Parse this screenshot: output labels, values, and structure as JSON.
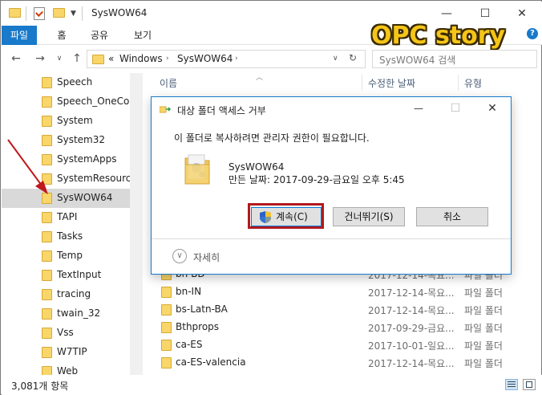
{
  "window": {
    "title": "SysWOW64",
    "minimize_glyph": "—",
    "maximize_glyph": "☐",
    "close_glyph": "✕"
  },
  "ribbon": {
    "tabs": [
      "파일",
      "홈",
      "공유",
      "보기"
    ],
    "help_glyph": "?"
  },
  "brand": "OPC story",
  "address": {
    "overflow": "«",
    "crumbs": [
      "Windows",
      "SysWOW64"
    ],
    "search_placeholder": "SysWOW64 검색"
  },
  "sidebar": {
    "items": [
      {
        "label": "Speech",
        "selected": false
      },
      {
        "label": "Speech_OneCore",
        "selected": false
      },
      {
        "label": "System",
        "selected": false
      },
      {
        "label": "System32",
        "selected": false
      },
      {
        "label": "SystemApps",
        "selected": false
      },
      {
        "label": "SystemResources",
        "selected": false
      },
      {
        "label": "SysWOW64",
        "selected": true
      },
      {
        "label": "TAPI",
        "selected": false
      },
      {
        "label": "Tasks",
        "selected": false
      },
      {
        "label": "Temp",
        "selected": false
      },
      {
        "label": "TextInput",
        "selected": false
      },
      {
        "label": "tracing",
        "selected": false
      },
      {
        "label": "twain_32",
        "selected": false
      },
      {
        "label": "Vss",
        "selected": false
      },
      {
        "label": "W7TIP",
        "selected": false
      },
      {
        "label": "Web",
        "selected": false
      }
    ]
  },
  "filelist": {
    "columns": [
      "이름",
      "수정한 날짜",
      "유형"
    ],
    "rows": [
      {
        "name": "bn-BD",
        "date": "2017-12-14-목요...",
        "type": "파일 폴더"
      },
      {
        "name": "bn-IN",
        "date": "2017-12-14-목요...",
        "type": "파일 폴더"
      },
      {
        "name": "bs-Latn-BA",
        "date": "2017-12-14-목요...",
        "type": "파일 폴더"
      },
      {
        "name": "Bthprops",
        "date": "2017-09-29-금요...",
        "type": "파일 폴더"
      },
      {
        "name": "ca-ES",
        "date": "2017-10-01-일요...",
        "type": "파일 폴더"
      },
      {
        "name": "ca-ES-valencia",
        "date": "2017-12-14-목요...",
        "type": "파일 폴더"
      }
    ]
  },
  "status": {
    "count": "3,081개 항목"
  },
  "dialog": {
    "title": "대상 폴더 액세스 거부",
    "message": "이 폴더로 복사하려면 관리자 권한이 필요합니다.",
    "folder_name": "SysWOW64",
    "folder_date": "만든 날짜: 2017-09-29-금요일 오후 5:45",
    "continue_label": "계속(C)",
    "skip_label": "건너뛰기(S)",
    "cancel_label": "취소",
    "details_label": "자세히",
    "details_glyph": "∨"
  },
  "colors": {
    "accent": "#1979ca",
    "highlight": "#b0191e",
    "brand": "#f5c518"
  }
}
